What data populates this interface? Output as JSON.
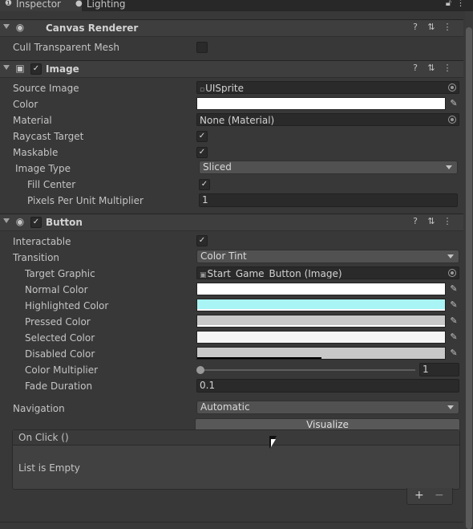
{
  "tabs": {
    "inspector": "Inspector",
    "lighting": "Lighting"
  },
  "canvas_renderer": {
    "title": "Canvas Renderer",
    "cull_transparent_mesh_label": "Cull Transparent Mesh",
    "cull_transparent_mesh_checked": false
  },
  "image": {
    "title": "Image",
    "source_image_label": "Source Image",
    "source_image_value": "UISprite",
    "color_label": "Color",
    "color_value": "#ffffff",
    "material_label": "Material",
    "material_value": "None (Material)",
    "raycast_target_label": "Raycast Target",
    "raycast_target_checked": true,
    "maskable_label": "Maskable",
    "maskable_checked": true,
    "image_type_label": "Image Type",
    "image_type_value": "Sliced",
    "fill_center_label": "Fill Center",
    "fill_center_checked": true,
    "ppu_label": "Pixels Per Unit Multiplier",
    "ppu_value": "1"
  },
  "button": {
    "title": "Button",
    "interactable_label": "Interactable",
    "interactable_checked": true,
    "transition_label": "Transition",
    "transition_value": "Color Tint",
    "target_graphic_label": "Target Graphic",
    "target_graphic_value": "Start_Game_Button (Image)",
    "normal_color_label": "Normal Color",
    "normal_color_value": "#ffffff",
    "highlighted_color_label": "Highlighted Color",
    "highlighted_color_value": "#a9f4f4",
    "pressed_color_label": "Pressed Color",
    "pressed_color_value": "#c8c8c8",
    "selected_color_label": "Selected Color",
    "selected_color_value": "#f5f5f5",
    "disabled_color_label": "Disabled Color",
    "disabled_color_value": "#c8c8c8",
    "color_multiplier_label": "Color Multiplier",
    "color_multiplier_value": "1",
    "fade_duration_label": "Fade Duration",
    "fade_duration_value": "0.1",
    "navigation_label": "Navigation",
    "navigation_value": "Automatic",
    "visualize_label": "Visualize",
    "on_click_label": "On Click ()",
    "list_empty_label": "List is Empty",
    "add_label": "+",
    "remove_label": "−"
  },
  "header_buttons": {
    "help": "?",
    "presets": "⇅",
    "menu": "⋮"
  }
}
